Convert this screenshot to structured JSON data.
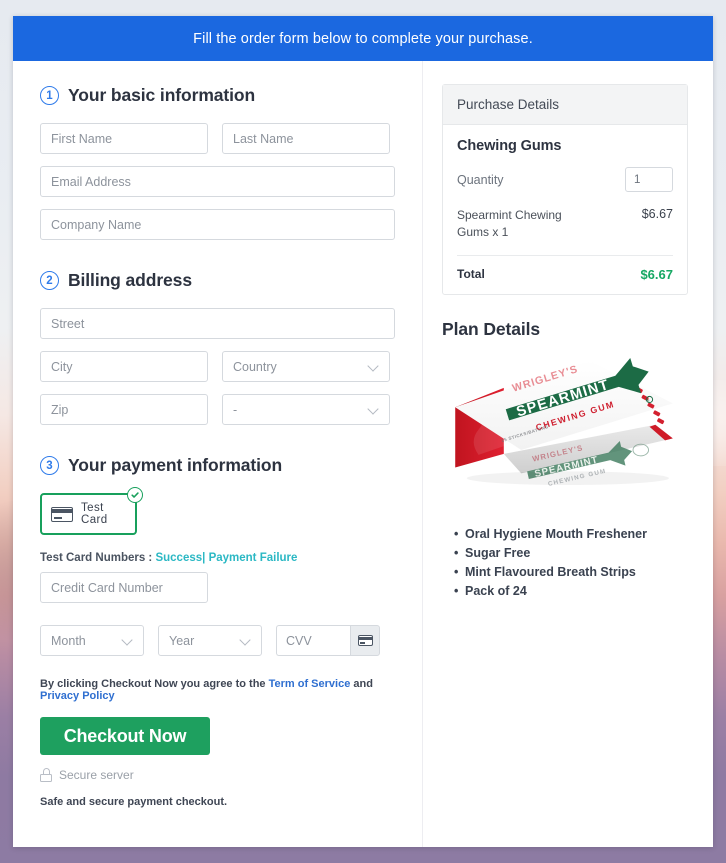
{
  "header": {
    "banner_text": "Fill the order form below to complete your purchase.",
    "banner_color": "#1b68e0"
  },
  "sections": {
    "basic": {
      "step": "1",
      "title": "Your basic information",
      "first_name_placeholder": "First Name",
      "last_name_placeholder": "Last Name",
      "email_placeholder": "Email Address",
      "company_placeholder": "Company Name"
    },
    "billing": {
      "step": "2",
      "title": "Billing address",
      "street_placeholder": "Street",
      "city_placeholder": "City",
      "country_placeholder": "Country",
      "zip_placeholder": "Zip",
      "state_placeholder": "-"
    },
    "payment": {
      "step": "3",
      "title": "Your payment information",
      "card_choice_label": "Test Card",
      "card_choice_selected": true,
      "test_card_prefix": "Test Card Numbers :",
      "test_card_success": "Success",
      "test_card_separator": "|",
      "test_card_failure": "Payment Failure",
      "link_color": "#2bb8c4",
      "credit_card_placeholder": "Credit Card Number",
      "month_placeholder": "Month",
      "year_placeholder": "Year",
      "cvv_placeholder": "CVV"
    }
  },
  "footer": {
    "terms_prefix": "By clicking Checkout Now you agree to the",
    "terms_link": "Term of Service",
    "terms_and": "and",
    "privacy_link": "Privacy Policy",
    "terms_link_color": "#2f6fd0",
    "checkout_button": "Checkout Now",
    "checkout_button_color": "#1ea05f",
    "secure_server": "Secure server",
    "safe_note": "Safe and secure payment checkout."
  },
  "purchase": {
    "panel_title": "Purchase Details",
    "product_name": "Chewing Gums",
    "quantity_label": "Quantity",
    "quantity_value": "1",
    "line_item_desc": "Spearmint Chewing Gums x 1",
    "line_item_price": "$6.67",
    "total_label": "Total",
    "total_value": "$6.67",
    "total_color": "#16a863"
  },
  "plan": {
    "title": "Plan Details",
    "product_image_alt": "spearmint-chewing-gum-box",
    "brand_text": "WRIGLEY'S",
    "product_text": "SPEARMINT",
    "subtitle_text": "CHEWING GUM",
    "features": [
      "Oral Hygiene Mouth Freshener",
      "Sugar Free",
      "Mint Flavoured Breath Strips",
      "Pack of 24"
    ]
  }
}
